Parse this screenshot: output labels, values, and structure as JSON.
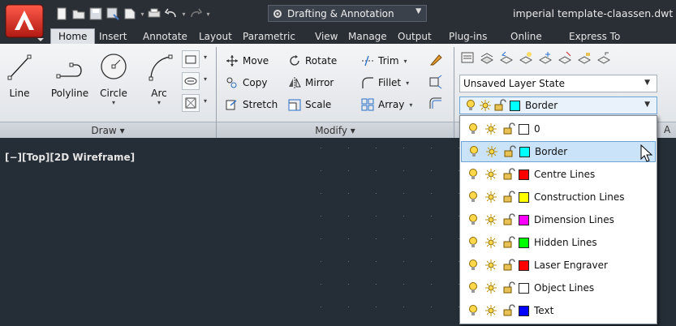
{
  "titlebar": {
    "workspace": "Drafting & Annotation",
    "document_title": "imperial template-claassen.dwt"
  },
  "tabs": [
    "Home",
    "Insert",
    "Annotate",
    "Layout",
    "Parametric",
    "View",
    "Manage",
    "Output",
    "Plug-ins",
    "Online",
    "Express To"
  ],
  "active_tab": "Home",
  "draw_panel": {
    "tools": [
      "Line",
      "Polyline",
      "Circle",
      "Arc"
    ],
    "footer": "Draw ▾"
  },
  "modify_panel": {
    "rows": [
      [
        "Move",
        "Rotate",
        "Trim"
      ],
      [
        "Copy",
        "Mirror",
        "Fillet"
      ],
      [
        "Stretch",
        "Scale",
        "Array"
      ]
    ],
    "footer": "Modify ▾"
  },
  "layers_panel": {
    "layer_state": "Unsaved Layer State",
    "current_layer": "Border"
  },
  "viewport": {
    "label": "[−][Top][2D Wireframe]"
  },
  "layer_list": [
    {
      "name": "0",
      "color": "#ffffff"
    },
    {
      "name": "Border",
      "color": "#00ffff"
    },
    {
      "name": "Centre Lines",
      "color": "#ff0000"
    },
    {
      "name": "Construction Lines",
      "color": "#ffff00"
    },
    {
      "name": "Dimension Lines",
      "color": "#ff00ff"
    },
    {
      "name": "Hidden Lines",
      "color": "#00ff00"
    },
    {
      "name": "Laser Engraver",
      "color": "#ff0000"
    },
    {
      "name": "Object Lines",
      "color": "#ffffff"
    },
    {
      "name": "Text",
      "color": "#0000ff"
    }
  ],
  "selected_layer": "Border",
  "colors": {
    "accent_selection": "#cbe3f8",
    "titlebar": "#2a2f36",
    "viewport": "#252d36"
  }
}
